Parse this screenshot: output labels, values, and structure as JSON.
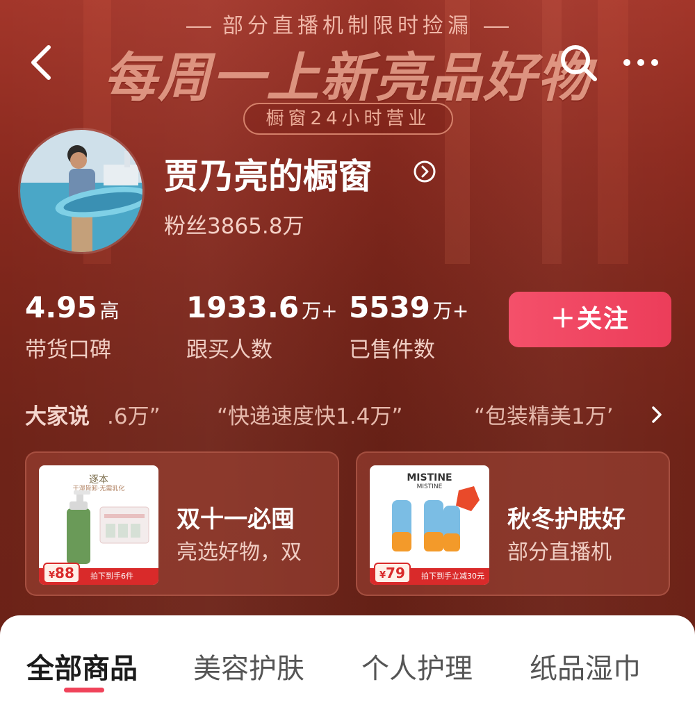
{
  "banner": {
    "subtitle": "部分直播机制限时捡漏",
    "title": "每周一上新亮品好物",
    "pill": "橱窗24小时营业"
  },
  "nav": {
    "back_icon": "chevron-left-icon",
    "search_icon": "search-icon",
    "more_icon": "more-dots-icon"
  },
  "profile": {
    "shop_name": "贾乃亮的橱窗",
    "fans": "粉丝3865.8万"
  },
  "stats": [
    {
      "value": "4.95",
      "unit": "高",
      "label": "带货口碑"
    },
    {
      "value": "1933.6",
      "unit": "万+",
      "label": "跟买人数"
    },
    {
      "value": "5539",
      "unit": "万+",
      "label": "已售件数"
    }
  ],
  "follow_button": "＋关注",
  "reviews": {
    "title": "大家说",
    "items": [
      ".6万”",
      "“快递速度快1.4万”",
      "“包装精美1万’"
    ]
  },
  "cards": [
    {
      "title": "双十一必囤",
      "subtitle": "亮选好物，双",
      "brand": "逐本",
      "brand_sub": "干湿皆卸·无需乳化",
      "price": "88",
      "currency": "¥",
      "footer": "拍下到手6件"
    },
    {
      "title": "秋冬护肤好",
      "subtitle": "部分直播机",
      "brand": "MISTINE",
      "brand_sub": "MISTINE",
      "price": "79",
      "currency": "¥",
      "footer": "拍下到手立减30元"
    }
  ],
  "tabs": [
    {
      "label": "全部商品",
      "active": true
    },
    {
      "label": "美容护肤",
      "active": false
    },
    {
      "label": "个人护理",
      "active": false
    },
    {
      "label": "纸品湿巾",
      "active": false
    }
  ],
  "colors": {
    "background": "#7a2418",
    "follow": "#f0435a",
    "tab_active_underline": "#f0435a"
  }
}
